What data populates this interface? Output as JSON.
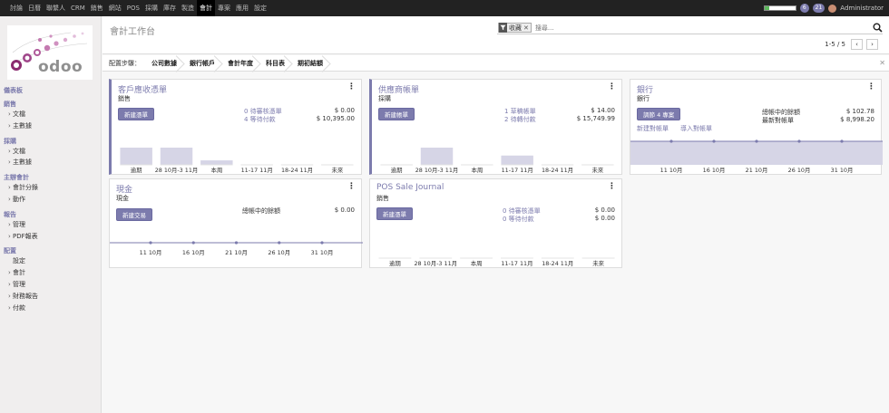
{
  "topbar": {
    "menu": [
      "討論",
      "日曆",
      "聯繫人",
      "CRM",
      "銷售",
      "網站",
      "POS",
      "採購",
      "庫存",
      "製造",
      "會計",
      "專案",
      "應用",
      "設定"
    ],
    "active_index": 10,
    "progress_fill": 0.15,
    "badge_messages": "6",
    "badge_activities": "21",
    "user": "Administrator"
  },
  "sidebar": {
    "logo_text": "odoo",
    "sections": [
      {
        "title": "儀表板",
        "items": []
      },
      {
        "title": "銷售",
        "items": [
          {
            "label": "文檔",
            "caret": true
          },
          {
            "label": "主數據",
            "caret": true
          }
        ]
      },
      {
        "title": "採購",
        "items": [
          {
            "label": "文檔",
            "caret": true
          },
          {
            "label": "主數據",
            "caret": true
          }
        ]
      },
      {
        "title": "主辦會計",
        "items": [
          {
            "label": "會計分錄",
            "caret": true
          },
          {
            "label": "動作",
            "caret": true
          }
        ]
      },
      {
        "title": "報告",
        "items": [
          {
            "label": "管理",
            "caret": true
          },
          {
            "label": "PDF報表",
            "caret": true
          }
        ]
      },
      {
        "title": "配置",
        "items": [
          {
            "label": "設定",
            "caret": false
          },
          {
            "label": "會計",
            "caret": true
          },
          {
            "label": "管理",
            "caret": true
          },
          {
            "label": "財務報告",
            "caret": true
          },
          {
            "label": "付款",
            "caret": true
          }
        ]
      }
    ]
  },
  "control_panel": {
    "breadcrumb": "會計工作台",
    "facet_label": "收藏",
    "search_placeholder": "搜尋...",
    "pager_value": "1-5 / 5"
  },
  "setup": {
    "label": "配置步驟：",
    "steps": [
      "公司數據",
      "銀行帳戶",
      "會計年度",
      "科目表",
      "期初結額"
    ]
  },
  "cards": [
    {
      "title": "客戶應收憑單",
      "subtitle": "銷售",
      "button": "新建憑單",
      "rows": [
        {
          "label": "0 待審核憑單",
          "amount": "$ 0.00"
        },
        {
          "label": "4 等待付款",
          "amount": "$ 10,395.00"
        }
      ],
      "chart_labels": [
        "逾期",
        "28 10月-3 11月",
        "本周",
        "11-17 11月",
        "18-24 11月",
        "未來"
      ]
    },
    {
      "title": "供應商帳單",
      "subtitle": "採購",
      "button": "新建帳單",
      "rows": [
        {
          "label": "1 草稿帳單",
          "amount": "$ 14.00"
        },
        {
          "label": "2 待轉付款",
          "amount": "$ 15,749.99"
        }
      ],
      "chart_labels": [
        "逾期",
        "28 10月-3 11月",
        "本周",
        "11-17 11月",
        "18-24 11月",
        "未來"
      ]
    },
    {
      "title": "銀行",
      "subtitle": "銀行",
      "button": "調節 4 專案",
      "rows": [
        {
          "label": "總帳中的餘額",
          "amount": "$ 102.78"
        },
        {
          "label": "最新對帳單",
          "amount": "$ 8,998.20"
        }
      ],
      "links": [
        "新建對帳單",
        "導入對帳單"
      ],
      "chart_labels": [
        "11 10月",
        "16 10月",
        "21 10月",
        "26 10月",
        "31 10月"
      ]
    },
    {
      "title": "現金",
      "subtitle": "現金",
      "button": "新建交易",
      "rows": [
        {
          "label": "總帳中的餘額",
          "amount": "$ 0.00"
        }
      ],
      "chart_labels": [
        "11 10月",
        "16 10月",
        "21 10月",
        "26 10月",
        "31 10月"
      ]
    },
    {
      "title": "POS Sale Journal",
      "subtitle": "銷售",
      "button": "新建憑單",
      "rows": [
        {
          "label": "0 待審核憑單",
          "amount": "$ 0.00"
        },
        {
          "label": "0 等待付款",
          "amount": "$ 0.00"
        }
      ],
      "chart_labels": [
        "逾期",
        "28 10月-3 11月",
        "本周",
        "11-17 11月",
        "18-24 11月",
        "未來"
      ]
    }
  ],
  "chart_data": [
    {
      "type": "bar",
      "categories": [
        "逾期",
        "28 10月-3 11月",
        "本周",
        "11-17 11月",
        "18-24 11月",
        "未來"
      ],
      "values": [
        10395,
        10395,
        2700,
        0,
        0,
        0
      ],
      "title": ""
    },
    {
      "type": "bar",
      "categories": [
        "逾期",
        "28 10月-3 11月",
        "本周",
        "11-17 11月",
        "18-24 11月",
        "未來"
      ],
      "values": [
        0,
        15749.99,
        0,
        8500,
        0,
        0
      ],
      "title": ""
    },
    {
      "type": "area",
      "categories": [
        "11 10月",
        "16 10月",
        "21 10月",
        "26 10月",
        "31 10月"
      ],
      "values": [
        102.78,
        102.78,
        102.78,
        102.78,
        102.78
      ],
      "title": ""
    },
    {
      "type": "line",
      "categories": [
        "11 10月",
        "16 10月",
        "21 10月",
        "26 10月",
        "31 10月"
      ],
      "values": [
        0,
        0,
        0,
        0,
        0
      ],
      "title": ""
    },
    {
      "type": "bar",
      "categories": [
        "逾期",
        "28 10月-3 11月",
        "本周",
        "11-17 11月",
        "18-24 11月",
        "未來"
      ],
      "values": [
        0,
        0,
        0,
        0,
        0,
        0
      ],
      "title": ""
    }
  ],
  "colors": {
    "accent": "#7c7bad",
    "topbar": "#222222",
    "bar_fill": "#d6d5e6"
  }
}
